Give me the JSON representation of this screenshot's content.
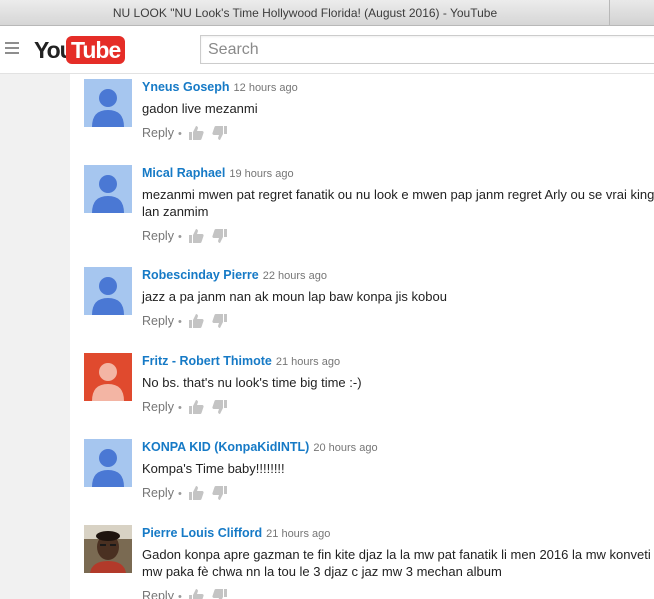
{
  "window": {
    "title": "NU LOOK \"NU Look's Time Hollywood Florida! (August 2016) - YouTube"
  },
  "masthead": {
    "logo_you": "You",
    "logo_tube": "Tube",
    "search_placeholder": "Search"
  },
  "comments": [
    {
      "author": "Yneus Goseph",
      "time": "12 hours ago",
      "text": "gadon live mezanmi",
      "reply_label": "Reply",
      "avatar": "default-blue"
    },
    {
      "author": "Mical Raphael",
      "time": "19 hours ago",
      "text": "mezanmi mwen pat regret fanatik ou nu look e mwen pap janm regret Arly ou se vrai king lan zanmim",
      "reply_label": "Reply",
      "avatar": "default-blue"
    },
    {
      "author": "Robescinday Pierre",
      "time": "22 hours ago",
      "text": "jazz a pa janm nan ak moun lap baw konpa jis kobou",
      "reply_label": "Reply",
      "avatar": "default-blue"
    },
    {
      "author": "Fritz - Robert Thimote",
      "time": "21 hours ago",
      "text": "No bs. that's nu look's time big time :-)",
      "reply_label": "Reply",
      "avatar": "default-orange"
    },
    {
      "author": "KONPA KID (KonpaKidINTL)",
      "time": "20 hours ago",
      "text": "Kompa's Time baby!!!!!!!!",
      "reply_label": "Reply",
      "avatar": "default-blue"
    },
    {
      "author": "Pierre Louis Clifford",
      "time": "21 hours ago",
      "text": "Gadon konpa apre gazman te fin kite djaz la la mw pat fanatik li men 2016 la mw konveti mw paka fè chwa nn la tou le 3 djaz c jaz mw 3 mechan album",
      "reply_label": "Reply",
      "avatar": "photo"
    }
  ],
  "colors": {
    "author": "#167ac6",
    "avatar_blue_bg": "#a6c6ef",
    "avatar_blue_fg": "#4a78d4",
    "avatar_orange_bg": "#e04a2e",
    "avatar_orange_fg": "#f3b5a4",
    "logo_red": "#e52d27"
  }
}
